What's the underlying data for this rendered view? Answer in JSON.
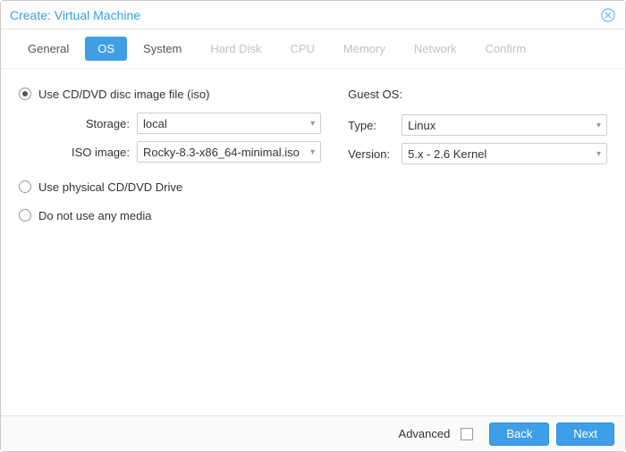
{
  "window": {
    "title": "Create: Virtual Machine"
  },
  "tabs": {
    "general": "General",
    "os": "OS",
    "system": "System",
    "hard_disk": "Hard Disk",
    "cpu": "CPU",
    "memory": "Memory",
    "network": "Network",
    "confirm": "Confirm"
  },
  "media": {
    "option_iso": "Use CD/DVD disc image file (iso)",
    "option_physical": "Use physical CD/DVD Drive",
    "option_none": "Do not use any media",
    "storage_label": "Storage:",
    "storage_value": "local",
    "iso_label": "ISO image:",
    "iso_value": "Rocky-8.3-x86_64-minimal.iso"
  },
  "guest_os": {
    "section_title": "Guest OS:",
    "type_label": "Type:",
    "type_value": "Linux",
    "version_label": "Version:",
    "version_value": "5.x - 2.6 Kernel"
  },
  "footer": {
    "advanced_label": "Advanced",
    "back": "Back",
    "next": "Next"
  }
}
